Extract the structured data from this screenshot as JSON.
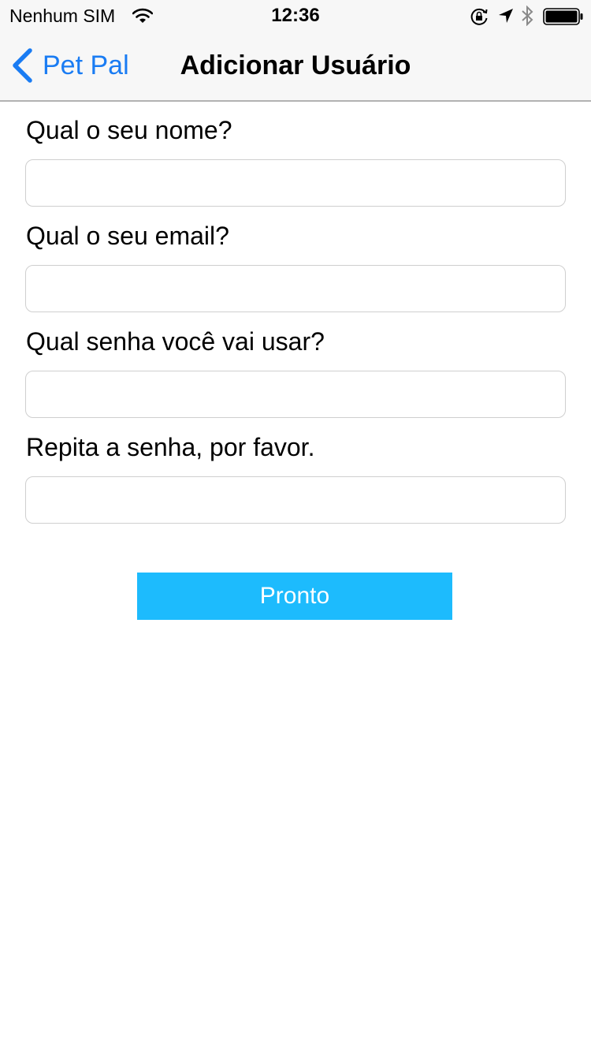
{
  "status_bar": {
    "carrier": "Nenhum SIM",
    "time": "12:36",
    "icons": [
      "wifi-icon",
      "orientation-lock-icon",
      "location-arrow-icon",
      "bluetooth-icon",
      "battery-icon"
    ]
  },
  "nav": {
    "back_label": "Pet Pal",
    "title": "Adicionar Usuário",
    "accent_color": "#1a7cf3"
  },
  "form": {
    "fields": [
      {
        "label": "Qual o seu nome?",
        "value": "",
        "placeholder": ""
      },
      {
        "label": "Qual o seu email?",
        "value": "",
        "placeholder": ""
      },
      {
        "label": "Qual senha você vai usar?",
        "value": "",
        "placeholder": ""
      },
      {
        "label": "Repita a senha, por favor.",
        "value": "",
        "placeholder": ""
      }
    ],
    "submit_label": "Pronto",
    "submit_color": "#1dbbfd"
  }
}
